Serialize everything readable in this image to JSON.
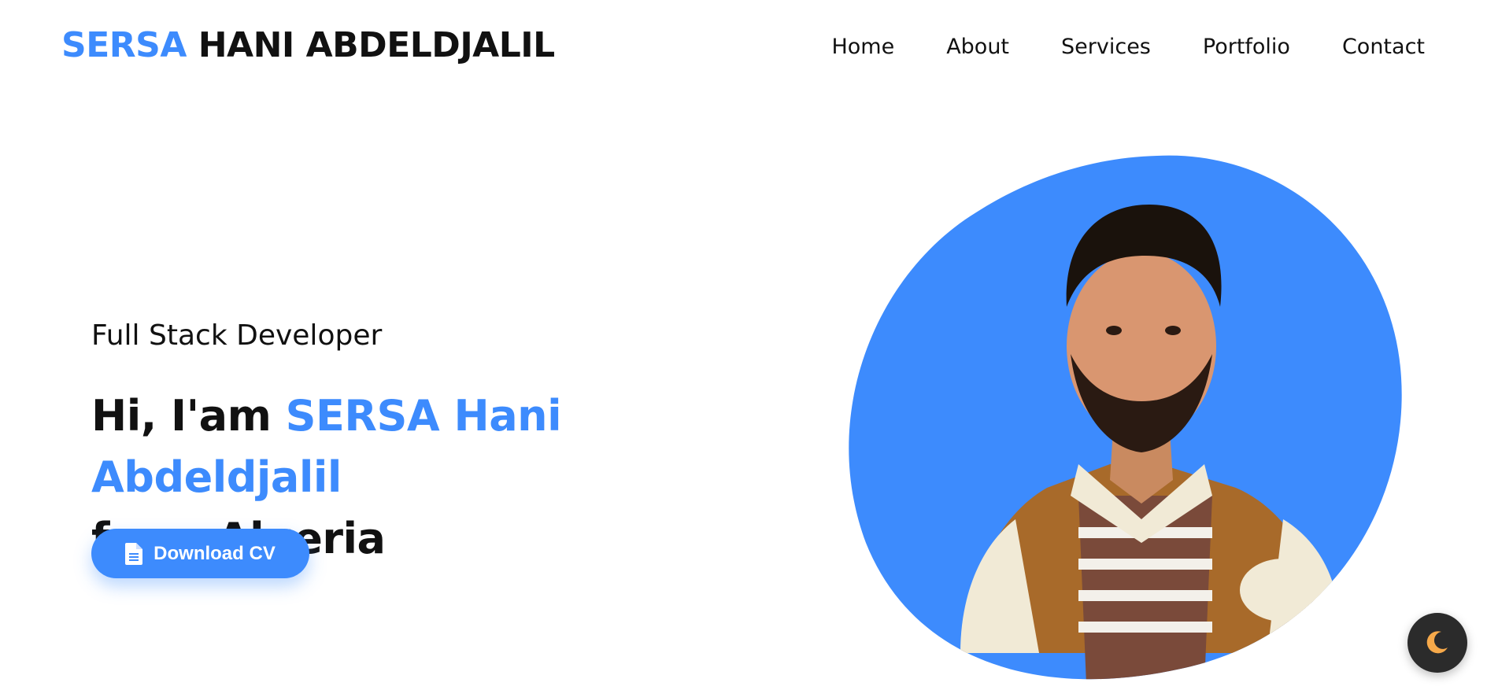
{
  "header": {
    "logo_accent": "SERSA",
    "logo_rest": " HANI ABDELDJALIL",
    "nav": [
      {
        "label": "Home"
      },
      {
        "label": "About"
      },
      {
        "label": "Services"
      },
      {
        "label": "Portfolio"
      },
      {
        "label": "Contact"
      }
    ]
  },
  "hero": {
    "role": "Full Stack Developer",
    "greeting": "Hi, I'am ",
    "name": "SERSA Hani Abdeldjalil",
    "origin": "from Algeria",
    "cta_label": "Download CV",
    "cta_icon": "document-icon",
    "photo_icon": "profile-photo"
  },
  "theme_toggle": {
    "icon": "moon-icon"
  },
  "colors": {
    "accent": "#3d8bfd",
    "text": "#111111",
    "toggle_bg": "#2b2b2b",
    "moon": "#f6a94a"
  }
}
